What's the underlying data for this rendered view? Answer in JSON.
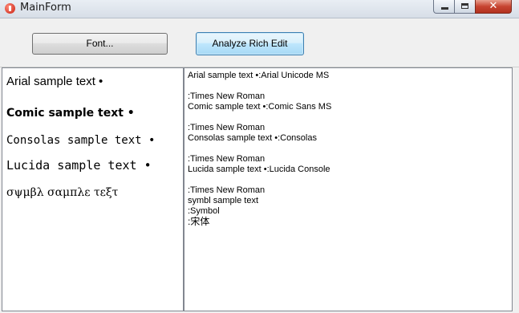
{
  "window": {
    "title": "MainForm",
    "close_glyph": "✕"
  },
  "toolbar": {
    "font_button": "Font...",
    "analyze_button": "Analyze Rich Edit"
  },
  "left_panel": {
    "samples": [
      "Arial sample text •",
      "Comic sample text •",
      "Consolas sample text •",
      "Lucida sample text •",
      "σψμβλ σαμπλε τεξτ"
    ]
  },
  "right_panel": {
    "lines": [
      "Arial sample text •:Arial Unicode MS",
      "",
      ":Times New Roman",
      "Comic sample text •:Comic Sans MS",
      "",
      ":Times New Roman",
      "Consolas sample text •:Consolas",
      "",
      ":Times New Roman",
      "Lucida sample text •:Lucida Console",
      "",
      ":Times New Roman",
      "symbl sample text",
      ":Symbol",
      ":宋体"
    ]
  }
}
